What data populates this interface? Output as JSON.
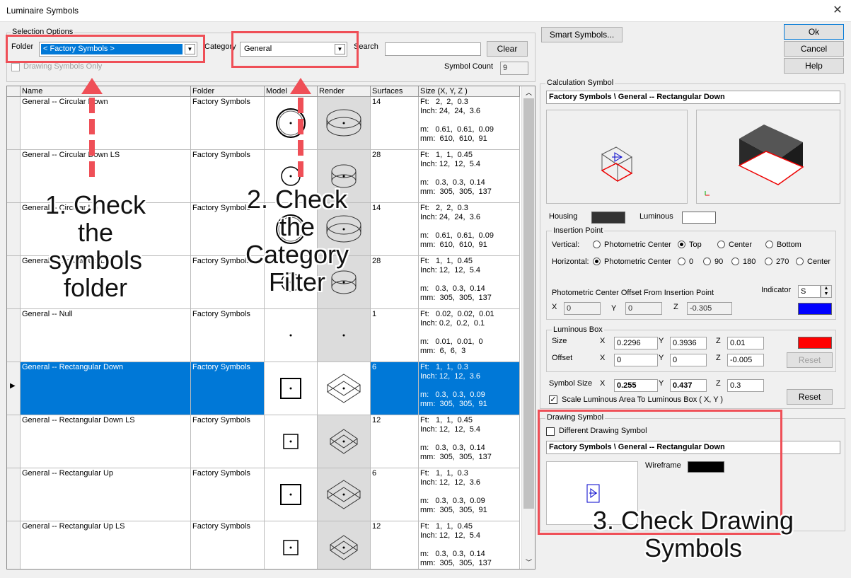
{
  "window": {
    "title": "Luminaire Symbols",
    "close_glyph": "✕"
  },
  "selection": {
    "group_label": "Selection Options",
    "folder_label": "Folder",
    "folder_value": "< Factory Symbols >",
    "category_label": "Category",
    "category_value": "General",
    "search_label": "Search",
    "search_value": "",
    "clear_label": "Clear",
    "drawing_only_label": "Drawing Symbols Only",
    "symbol_count_label": "Symbol Count",
    "symbol_count_value": "9"
  },
  "grid": {
    "columns": [
      "Name",
      "Folder",
      "Model",
      "Render",
      "Surfaces",
      "Size  (X, Y, Z )"
    ],
    "rows": [
      {
        "name": "General -- Circular Down",
        "folder": "Factory Symbols",
        "surfaces": "14",
        "size": "Ft:   2,  2,  0.3\nInch: 24,  24,  3.6\n\nm:   0.61,  0.61,  0.09\nmm:  610,  610,  91",
        "shape": "circle-large",
        "selected": false
      },
      {
        "name": "General -- Circular Down LS",
        "folder": "Factory Symbols",
        "surfaces": "28",
        "size": "Ft:   1,  1,  0.45\nInch: 12,  12,  5.4\n\nm:   0.3,  0.3,  0.14\nmm:  305,  305,  137",
        "shape": "circle-small",
        "selected": false
      },
      {
        "name": "General -- Circular Up",
        "folder": "Factory Symbols",
        "surfaces": "14",
        "size": "Ft:   2,  2,  0.3\nInch: 24,  24,  3.6\n\nm:   0.61,  0.61,  0.09\nmm:  610,  610,  91",
        "shape": "circle-large",
        "selected": false
      },
      {
        "name": "General -- Circular Up LS",
        "folder": "Factory Symbols",
        "surfaces": "28",
        "size": "Ft:   1,  1,  0.45\nInch: 12,  12,  5.4\n\nm:   0.3,  0.3,  0.14\nmm:  305,  305,  137",
        "shape": "circle-small",
        "selected": false
      },
      {
        "name": "General -- Null",
        "folder": "Factory Symbols",
        "surfaces": "1",
        "size": "Ft:   0.02,  0.02,  0.01\nInch: 0.2,  0.2,  0.1\n\nm:   0.01,  0.01,  0\nmm:  6,  6,  3",
        "shape": "dot",
        "selected": false
      },
      {
        "name": "General -- Rectangular Down",
        "folder": "Factory Symbols",
        "surfaces": "6",
        "size": "Ft:   1,  1,  0.3\nInch: 12,  12,  3.6\n\nm:   0.3,  0.3,  0.09\nmm:  305,  305,  91",
        "shape": "square-large",
        "selected": true
      },
      {
        "name": "General -- Rectangular Down LS",
        "folder": "Factory Symbols",
        "surfaces": "12",
        "size": "Ft:   1,  1,  0.45\nInch: 12,  12,  5.4\n\nm:   0.3,  0.3,  0.14\nmm:  305,  305,  137",
        "shape": "square-small",
        "selected": false
      },
      {
        "name": "General -- Rectangular Up",
        "folder": "Factory Symbols",
        "surfaces": "6",
        "size": "Ft:   1,  1,  0.3\nInch: 12,  12,  3.6\n\nm:   0.3,  0.3,  0.09\nmm:  305,  305,  91",
        "shape": "square-large",
        "selected": false
      },
      {
        "name": "General -- Rectangular Up LS",
        "folder": "Factory Symbols",
        "surfaces": "12",
        "size": "Ft:   1,  1,  0.45\nInch: 12,  12,  5.4\n\nm:   0.3,  0.3,  0.14\nmm:  305,  305,  137",
        "shape": "square-small",
        "selected": false
      }
    ]
  },
  "buttons": {
    "smart_symbols": "Smart Symbols...",
    "ok": "Ok",
    "cancel": "Cancel",
    "help": "Help"
  },
  "calc": {
    "group_label": "Calculation Symbol",
    "path": "Factory Symbols \\ General -- Rectangular Down",
    "housing_label": "Housing",
    "housing_color": "#333333",
    "luminous_label": "Luminous",
    "luminous_color": "#ffffff",
    "insertion_label": "Insertion Point",
    "vertical_label": "Vertical:",
    "vertical_options": [
      "Photometric Center",
      "Top",
      "Center",
      "Bottom"
    ],
    "vertical_selected": "Top",
    "horizontal_label": "Horizontal:",
    "horizontal_options": [
      "Photometric Center",
      "0",
      "90",
      "180",
      "270",
      "Center"
    ],
    "horizontal_selected": "Photometric Center",
    "offset_label": "Photometric Center Offset From Insertion Point",
    "indicator_label": "Indicator",
    "indicator_value": "S",
    "indicator_color": "#0000ff",
    "offset_x": "0",
    "offset_y": "0",
    "offset_z": "-0.305",
    "lumbox_label": "Luminous Box",
    "size_label": "Size",
    "size_x": "0.2296",
    "size_y": "0.3936",
    "size_z": "0.01",
    "lumbox_color": "#ff0000",
    "offset_row_label": "Offset",
    "off_x": "0",
    "off_y": "0",
    "off_z": "-0.005",
    "reset_label": "Reset",
    "symbol_size_label": "Symbol Size",
    "sym_x": "0.255",
    "sym_y": "0.437",
    "sym_z": "0.3",
    "scale_label": "Scale Luminous Area To Luminous Box ( X, Y )",
    "x": "X",
    "y": "Y",
    "z": "Z"
  },
  "drawing": {
    "group_label": "Drawing Symbol",
    "different_label": "Different Drawing Symbol",
    "path": "Factory Symbols \\ General -- Rectangular Down",
    "wireframe_label": "Wireframe",
    "wireframe_color": "#000000"
  },
  "annotations": {
    "a1": "1. Check the symbols folder",
    "a2": "2. Check the Category Filter",
    "a3": "3. Check Drawing Symbols",
    "color": "#ef4f57"
  }
}
